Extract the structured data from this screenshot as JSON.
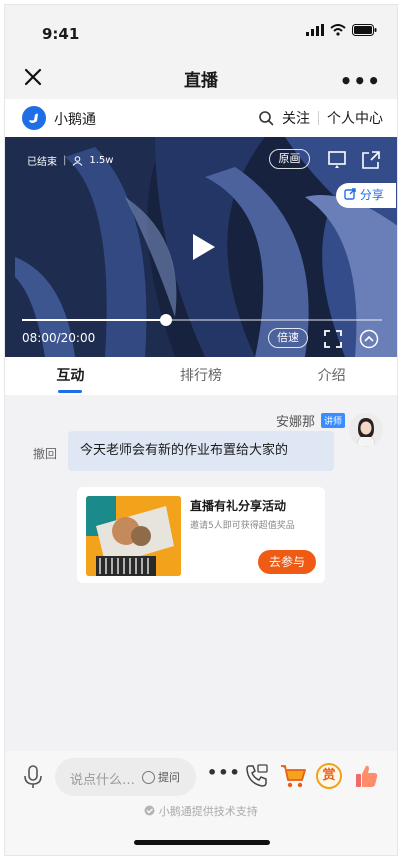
{
  "status_bar": {
    "time": "9:41"
  },
  "nav": {
    "title": "直播"
  },
  "brand": {
    "name": "小鹅通",
    "follow": "关注",
    "personal_center": "个人中心"
  },
  "video": {
    "status": "已结束",
    "viewers": "1.5w",
    "original_label": "原画",
    "share_label": "分享",
    "time_display": "08:00/20:00",
    "speed_label": "倍速",
    "progress": 0.4
  },
  "tabs": [
    {
      "label": "互动",
      "active": true
    },
    {
      "label": "排行榜",
      "active": false
    },
    {
      "label": "介绍",
      "active": false
    }
  ],
  "chat": {
    "sender": "安娜那",
    "sender_badge": "讲师",
    "recall_label": "撤回",
    "message": "今天老师会有新的作业布置给大家的",
    "card": {
      "title": "直播有礼分享活动",
      "desc": "邀请5人即可获得超值奖品",
      "button": "去参与"
    }
  },
  "bottom": {
    "input_placeholder": "说点什么…",
    "ask_label": "提问",
    "more": "•••",
    "reward_label": "赏",
    "support_text": "小鹅通提供技术支持"
  },
  "colors": {
    "accent": "#1e6fe6",
    "orange": "#ef5a14",
    "bubble": "#dfe7f5"
  }
}
